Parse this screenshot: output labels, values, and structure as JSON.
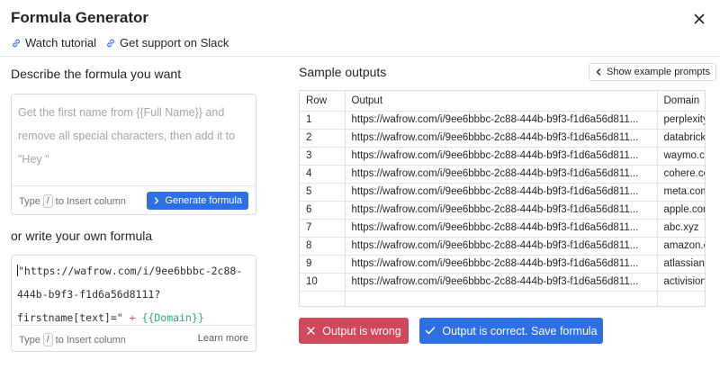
{
  "modal": {
    "title": "Formula Generator",
    "links": {
      "tutorial": "Watch tutorial",
      "support": "Get support on Slack"
    }
  },
  "describe": {
    "heading": "Describe the formula you want",
    "placeholder_lines": [
      "Get the first name from {{Full Name}} and",
      "remove all special characters, then add it to",
      "\"Hey \""
    ],
    "hint_prefix": "Type",
    "hint_key": "/",
    "hint_suffix": "to Insert column",
    "generate_label": "Generate formula"
  },
  "own": {
    "heading": "or write your own formula",
    "code_lines": [
      "\"https://wafrow.com/i/9ee6bbbc-2c88-",
      "444b-b9f3-f1d6a56d8111?",
      "firstname[text]=\""
    ],
    "code_op": "+",
    "code_ref": "{{Domain}}",
    "hint_prefix": "Type",
    "hint_key": "/",
    "hint_suffix": "to Insert column",
    "learn_more": "Learn more"
  },
  "samples": {
    "heading": "Sample outputs",
    "example_button": "Show example prompts",
    "columns": [
      "Row",
      "Output",
      "Domain"
    ],
    "rows": [
      {
        "row": "1",
        "output": "https://wafrow.com/i/9ee6bbbc-2c88-444b-b9f3-f1d6a56d811...",
        "domain": "perplexity.ai"
      },
      {
        "row": "2",
        "output": "https://wafrow.com/i/9ee6bbbc-2c88-444b-b9f3-f1d6a56d811...",
        "domain": "databricks.com"
      },
      {
        "row": "3",
        "output": "https://wafrow.com/i/9ee6bbbc-2c88-444b-b9f3-f1d6a56d811...",
        "domain": "waymo.com"
      },
      {
        "row": "4",
        "output": "https://wafrow.com/i/9ee6bbbc-2c88-444b-b9f3-f1d6a56d811...",
        "domain": "cohere.com"
      },
      {
        "row": "5",
        "output": "https://wafrow.com/i/9ee6bbbc-2c88-444b-b9f3-f1d6a56d811...",
        "domain": "meta.com"
      },
      {
        "row": "6",
        "output": "https://wafrow.com/i/9ee6bbbc-2c88-444b-b9f3-f1d6a56d811...",
        "domain": "apple.com"
      },
      {
        "row": "7",
        "output": "https://wafrow.com/i/9ee6bbbc-2c88-444b-b9f3-f1d6a56d811...",
        "domain": "abc.xyz"
      },
      {
        "row": "8",
        "output": "https://wafrow.com/i/9ee6bbbc-2c88-444b-b9f3-f1d6a56d811...",
        "domain": "amazon.com"
      },
      {
        "row": "9",
        "output": "https://wafrow.com/i/9ee6bbbc-2c88-444b-b9f3-f1d6a56d811...",
        "domain": "atlassian.com"
      },
      {
        "row": "10",
        "output": "https://wafrow.com/i/9ee6bbbc-2c88-444b-b9f3-f1d6a56d811...",
        "domain": "activision.com"
      }
    ]
  },
  "actions": {
    "wrong_label": "Output is wrong",
    "correct_label": "Output is correct. Save formula"
  },
  "colors": {
    "primary": "#2f6fe4",
    "danger": "#d2485b",
    "formula_operator": "#d05959",
    "formula_reference": "#2ea77f"
  }
}
